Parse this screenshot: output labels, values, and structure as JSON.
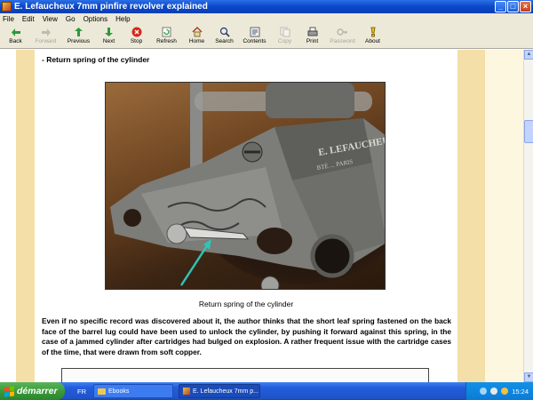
{
  "window": {
    "title": "E. Lefaucheux 7mm pinfire revolver explained",
    "controls": {
      "minimize": "_",
      "maximize": "□",
      "close": "×"
    }
  },
  "menu": [
    "File",
    "Edit",
    "View",
    "Go",
    "Options",
    "Help"
  ],
  "toolbar": [
    {
      "label": "Back",
      "icon": "back-arrow-icon",
      "enabled": true
    },
    {
      "label": "Forward",
      "icon": "forward-arrow-icon",
      "enabled": false
    },
    {
      "label": "Previous",
      "icon": "up-arrow-icon",
      "enabled": true
    },
    {
      "label": "Next",
      "icon": "down-arrow-icon",
      "enabled": true
    },
    {
      "label": "Stop",
      "icon": "stop-icon",
      "enabled": true
    },
    {
      "label": "Refresh",
      "icon": "refresh-icon",
      "enabled": true
    },
    {
      "label": "Home",
      "icon": "home-icon",
      "enabled": true
    },
    {
      "label": "Search",
      "icon": "search-icon",
      "enabled": true
    },
    {
      "label": "Contents",
      "icon": "contents-icon",
      "enabled": true
    },
    {
      "label": "Copy",
      "icon": "copy-icon",
      "enabled": false
    },
    {
      "label": "Print",
      "icon": "print-icon",
      "enabled": true
    },
    {
      "label": "Password",
      "icon": "key-icon",
      "enabled": false
    },
    {
      "label": "About",
      "icon": "about-icon",
      "enabled": true
    }
  ],
  "content": {
    "section_heading": "- Return spring of the cylinder",
    "photo_engraving": [
      "E. LEFAUCHEUX",
      "BTÉ ... PARIS"
    ],
    "caption": "Return spring of the cylinder",
    "body": "Even if no specific record was discovered about it, the author thinks that the short leaf spring fastened on the back face of the barrel lug could have been used to unlock the cylinder, by pushing it forward against this spring, in the case of a jammed cylinder after cartridges had bulged on explosion. A rather frequent issue with the cartridge cases of the time, that were drawn from soft copper."
  },
  "taskbar": {
    "start_label": "démarrer",
    "language": "FR",
    "tasks": [
      "Ebooks",
      "E. Lefaucheux 7mm p..."
    ],
    "clock": "15:24"
  },
  "colors": {
    "page_band": "#f5dfa8",
    "outer_band": "#fef7e0",
    "arrow": "#2ec4b6",
    "taskbar": "#245ddb",
    "start_button": "#3a9a3a"
  }
}
